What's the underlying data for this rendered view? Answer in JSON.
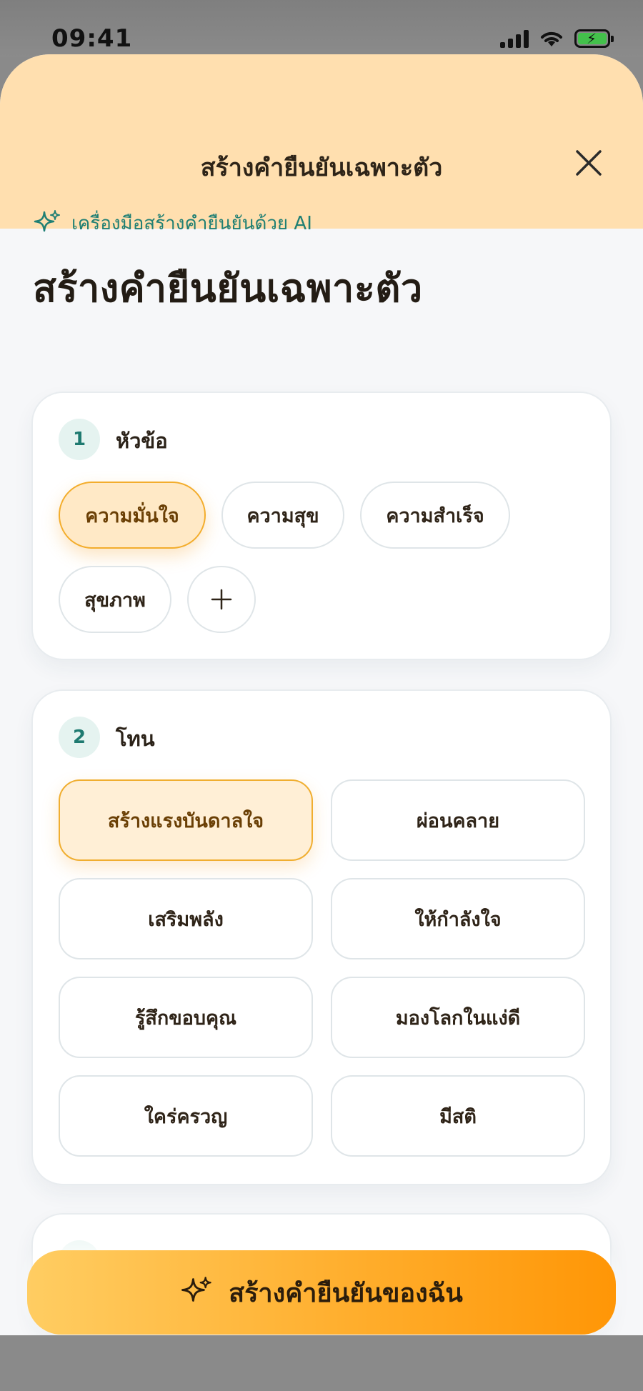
{
  "status_bar": {
    "time": "09:41"
  },
  "header": {
    "title": "สร้างคำยืนยันเฉพาะตัว",
    "close_icon": "close-icon"
  },
  "intro": {
    "eyebrow": "เครื่องมือสร้างคำยืนยันด้วย AI",
    "title": "สร้างคำยืนยันเฉพาะตัว"
  },
  "topic_section": {
    "step": "1",
    "label": "หัวข้อ",
    "options": [
      "ความมั่นใจ",
      "ความสุข",
      "ความสำเร็จ",
      "สุขภาพ"
    ],
    "selected": "ความมั่นใจ",
    "add_icon": "plus-icon"
  },
  "tone_section": {
    "step": "2",
    "label": "โทน",
    "options": [
      "สร้างแรงบันดาลใจ",
      "ผ่อนคลาย",
      "เสริมพลัง",
      "ให้กำลังใจ",
      "รู้สึกขอบคุณ",
      "มองโลกในแง่ดี",
      "ใคร่ครวญ",
      "มีสติ"
    ],
    "selected": "สร้างแรงบันดาลใจ"
  },
  "cta": {
    "label": "สร้างคำยืนยันของฉัน",
    "icon": "sparkle-icon"
  },
  "colors": {
    "accent": "#ffa31a",
    "header_bg": "#ffdfaf",
    "teal": "#1f7f74"
  }
}
